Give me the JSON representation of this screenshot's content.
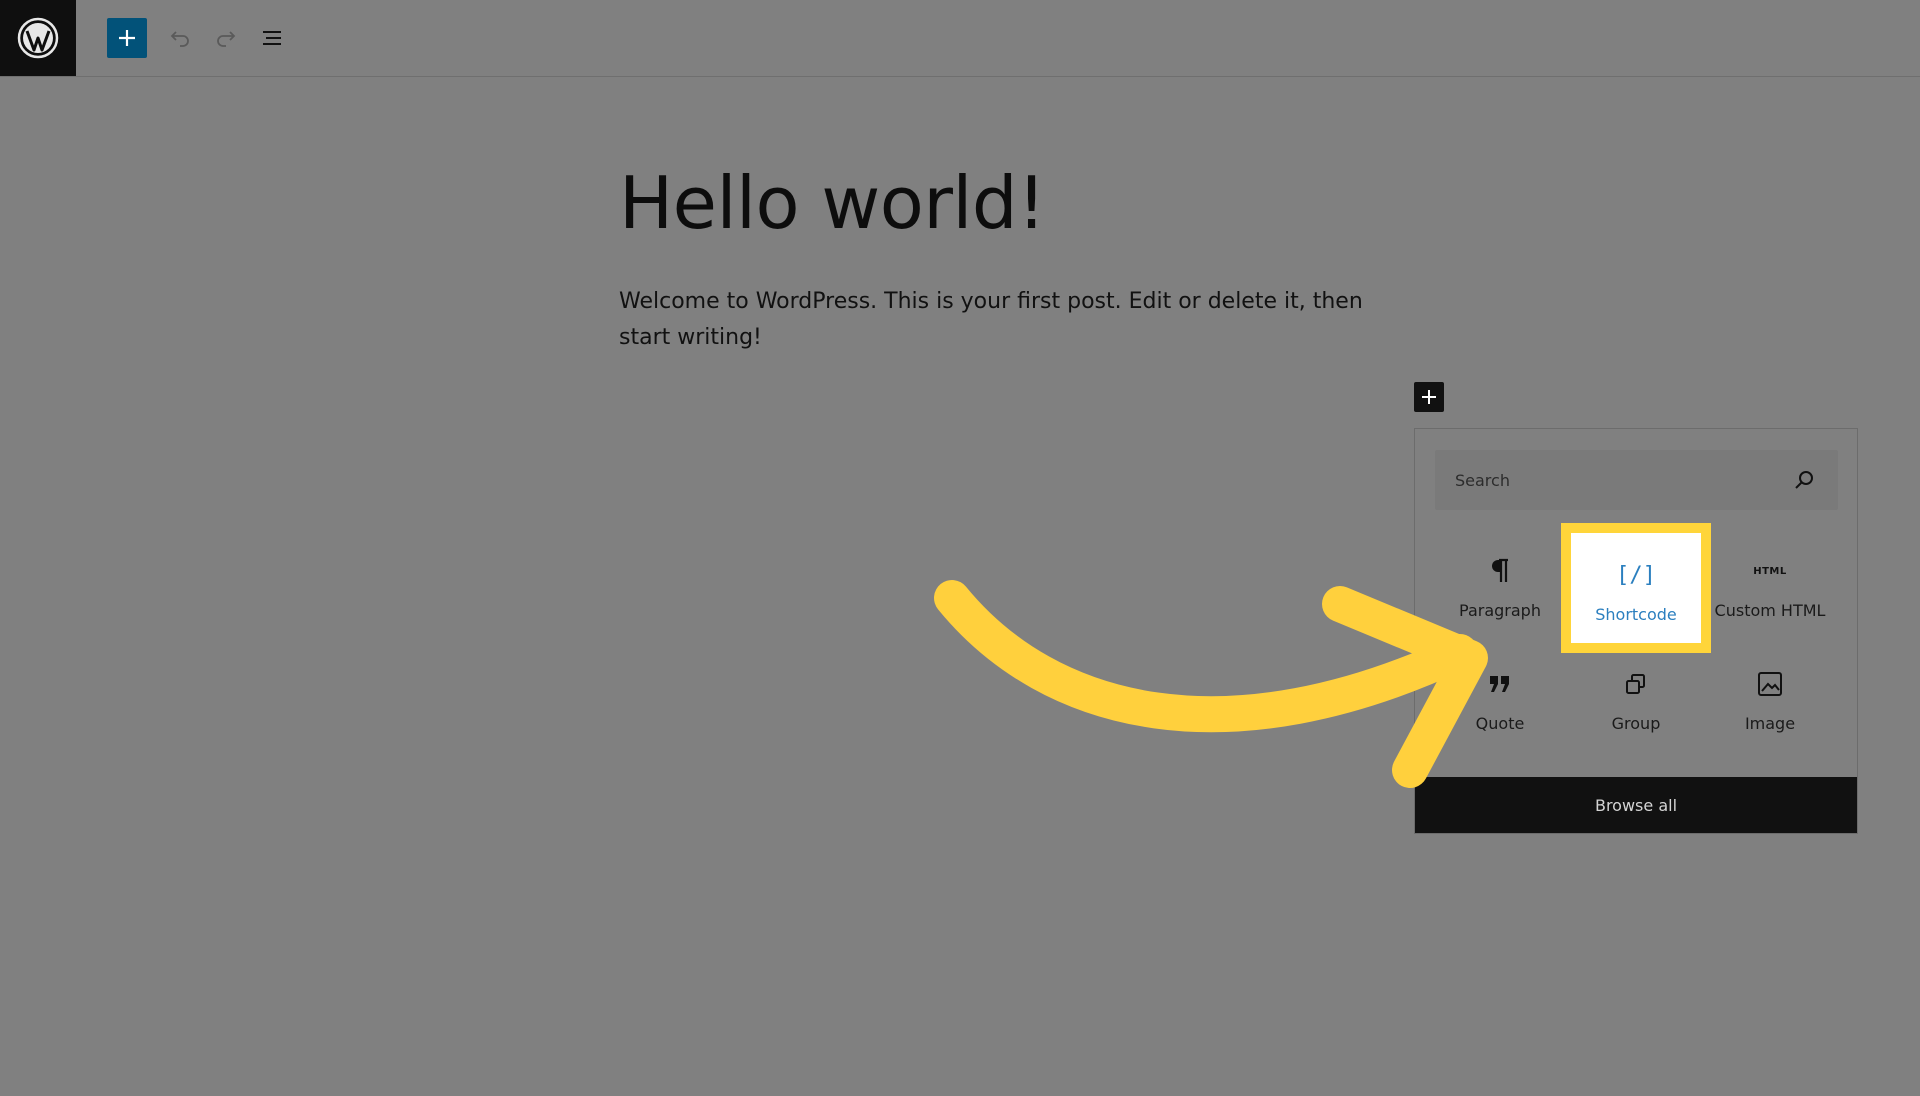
{
  "toolbar": {
    "logo_icon": "wordpress-logo-icon",
    "add_icon": "plus-icon",
    "undo_icon": "undo-icon",
    "redo_icon": "redo-icon",
    "outline_icon": "list-view-icon",
    "accent": "#025279"
  },
  "post": {
    "title": "Hello world!",
    "body": "Welcome to WordPress. This is your first post. Edit or delete it, then start writing!"
  },
  "inserter": {
    "search_placeholder": "Search",
    "blocks": [
      {
        "label": "Paragraph",
        "icon": "paragraph-icon"
      },
      {
        "label": "Shortcode",
        "icon": "shortcode-icon",
        "highlighted": true
      },
      {
        "label": "Custom HTML",
        "icon": "html-icon"
      },
      {
        "label": "Quote",
        "icon": "quote-icon"
      },
      {
        "label": "Group",
        "icon": "group-icon"
      },
      {
        "label": "Image",
        "icon": "image-icon"
      }
    ],
    "html_icon_text": "HTML",
    "shortcode_icon_text": "[/]",
    "browse_all": "Browse all"
  },
  "annotation": {
    "color": "#ffd03d",
    "icon": "curved-arrow-icon"
  }
}
